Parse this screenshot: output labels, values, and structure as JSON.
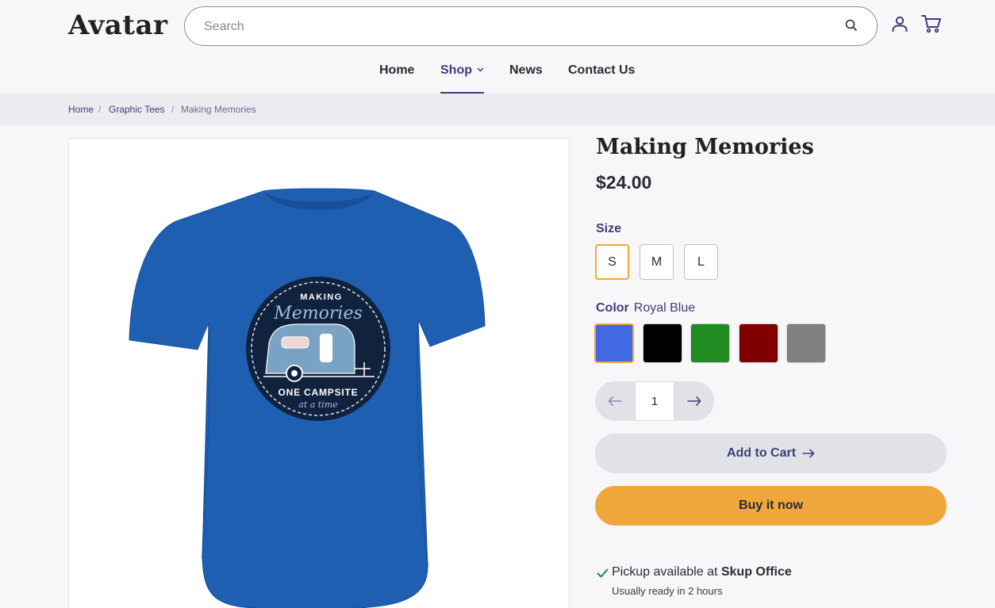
{
  "header": {
    "logo": "Avatar",
    "search_placeholder": "Search"
  },
  "nav": {
    "items": [
      {
        "label": "Home"
      },
      {
        "label": "Shop"
      },
      {
        "label": "News"
      },
      {
        "label": "Contact Us"
      }
    ]
  },
  "breadcrumb": {
    "items": [
      "Home",
      "Graphic Tees",
      "Making Memories"
    ],
    "separator": "/"
  },
  "product": {
    "title": "Making Memories",
    "price": "$24.00",
    "size_label": "Size",
    "sizes": [
      "S",
      "M",
      "L"
    ],
    "selected_size": "S",
    "color_label": "Color",
    "selected_color": "Royal Blue",
    "colors": [
      {
        "hex": "#4169e1"
      },
      {
        "hex": "#000000"
      },
      {
        "hex": "#228b22"
      },
      {
        "hex": "#800000"
      },
      {
        "hex": "#808080"
      }
    ],
    "quantity": "1",
    "add_to_cart_label": "Add to Cart",
    "buy_now_label": "Buy it now",
    "image": {
      "badge_top": "MAKING",
      "badge_script": "Memories",
      "badge_bottom": "ONE CAMPSITE",
      "badge_tagline": "at a time"
    }
  },
  "pickup": {
    "prefix": "Pickup available at ",
    "location": "Skup Office",
    "eta": "Usually ready in 2 hours"
  },
  "colors": {
    "accent": "#3f3d7a",
    "buy_button": "#efa73c",
    "selected_border": "#efa73c",
    "success": "#1f8a4c"
  }
}
